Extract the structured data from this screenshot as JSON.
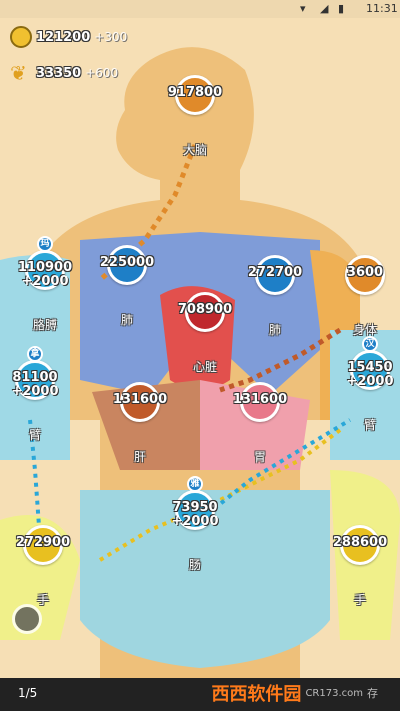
{
  "status_bar": {
    "time": "11:31",
    "icons": [
      "wifi-icon",
      "signal-icon",
      "battery-icon"
    ]
  },
  "resources": {
    "gold": {
      "value": "121200",
      "gain": "+300",
      "icon": "gold-coin-icon"
    },
    "grain": {
      "value": "33350",
      "gain": "+600",
      "icon": "wheat-icon"
    }
  },
  "nodes": [
    {
      "id": "brain",
      "count": "917800",
      "label": "大脑",
      "color": "#e08a2a"
    },
    {
      "id": "lung-left",
      "count": "225000",
      "label": "肺",
      "color": "#1e7fc7"
    },
    {
      "id": "lung-right",
      "count": "272700",
      "label": "肺",
      "color": "#1e7fc7"
    },
    {
      "id": "body",
      "count": "3600",
      "label": "身体",
      "color": "#e08a2a"
    },
    {
      "id": "heart",
      "count": "708900",
      "label": "心脏",
      "color": "#c0282d"
    },
    {
      "id": "arm-left",
      "count": "110900",
      "plus": "+2000",
      "label": "胳膊",
      "color": "#2aa7d8",
      "owner": "玛"
    },
    {
      "id": "side-left",
      "count": "81100",
      "plus": "+2000",
      "label": "臂",
      "color": "#2aa7d8",
      "owner": "拿"
    },
    {
      "id": "side-right",
      "count": "15450",
      "plus": "+2000",
      "label": "臂",
      "color": "#2aa7d8",
      "owner": "汉"
    },
    {
      "id": "liver",
      "count": "131600",
      "label": "肝",
      "color": "#c05a2a"
    },
    {
      "id": "stomach",
      "count": "131600",
      "label": "胃",
      "color": "#e8788a"
    },
    {
      "id": "intestine",
      "count": "73950",
      "plus": "+2000",
      "label": "肠",
      "color": "#2aa7d8",
      "owner": "雅"
    },
    {
      "id": "hand-left",
      "count": "272900",
      "label": "手",
      "color": "#e8c020"
    },
    {
      "id": "hand-right",
      "count": "288600",
      "label": "手",
      "color": "#e8c020"
    }
  ],
  "pager": {
    "text": "1/5"
  },
  "watermark": {
    "main": "西西软件园",
    "sub": "CR173.com",
    "extra": "存"
  }
}
